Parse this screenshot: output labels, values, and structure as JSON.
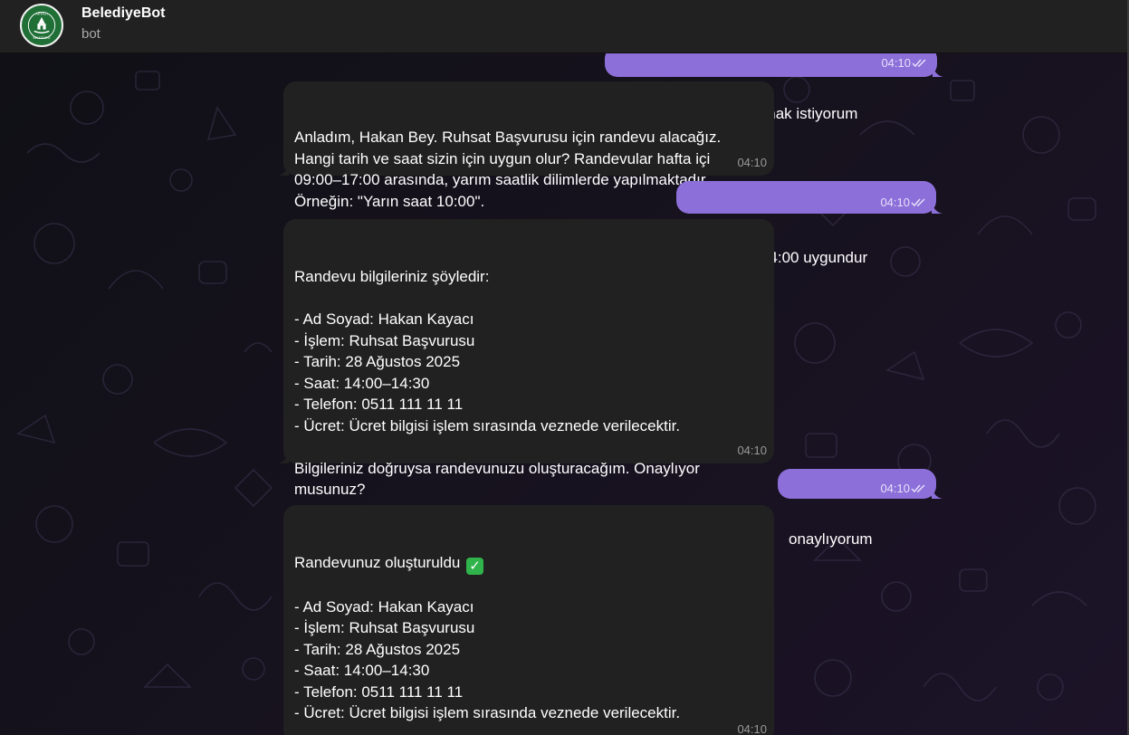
{
  "header": {
    "title": "BelediyeBot",
    "subtitle": "bot",
    "avatar_icon": "municipality-logo-icon",
    "avatar_logo_text": "AKYAZI BELEDİYESİ"
  },
  "theme": {
    "outgoing_bubble": "#8c6fd9",
    "incoming_bubble": "#212121",
    "header_bg": "#212121"
  },
  "messages": [
    {
      "direction": "out",
      "text": "ruhsat başvurusu yapmak istiyorum",
      "time": "04:10",
      "status": "read"
    },
    {
      "direction": "in",
      "text": "Anladım, Hakan Bey. Ruhsat Başvurusu için randevu alacağız.\nHangi tarih ve saat sizin için uygun olur? Randevular hafta içi\n09:00–17:00 arasında, yarım saatlik dilimlerde yapılmaktadır.\nÖrneğin: \"Yarın saat 10:00\".",
      "time": "04:10"
    },
    {
      "direction": "out",
      "text": "Yarın saat 14:00 uygundur",
      "time": "04:10",
      "status": "read"
    },
    {
      "direction": "in",
      "text": "Randevu bilgileriniz şöyledir:\n\n- Ad Soyad: Hakan Kayacı\n- İşlem: Ruhsat Başvurusu\n- Tarih: 28 Ağustos 2025\n- Saat: 14:00–14:30\n- Telefon: 0511 111 11 11\n- Ücret: Ücret bilgisi işlem sırasında veznede verilecektir.\n\nBilgileriniz doğruysa randevunuzu oluşturacağım. Onaylıyor\nmusunuz?",
      "time": "04:10"
    },
    {
      "direction": "out",
      "text": "onaylıyorum",
      "time": "04:10",
      "status": "read"
    },
    {
      "direction": "in",
      "text_first": "Randevunuz oluşturuldu",
      "text": "\n\n- Ad Soyad: Hakan Kayacı\n- İşlem: Ruhsat Başvurusu\n- Tarih: 28 Ağustos 2025\n- Saat: 14:00–14:30\n- Telefon: 0511 111 11 11\n- Ücret: Ücret bilgisi işlem sırasında veznede verilecektir.\n\nSaatinde ilgili birimde bulunmanız yeterlidir. İyi günler dilerim!",
      "time": "04:10",
      "emoji_1": "check-mark-button-emoji",
      "emoji_2": "smiling-face-emoji"
    }
  ]
}
